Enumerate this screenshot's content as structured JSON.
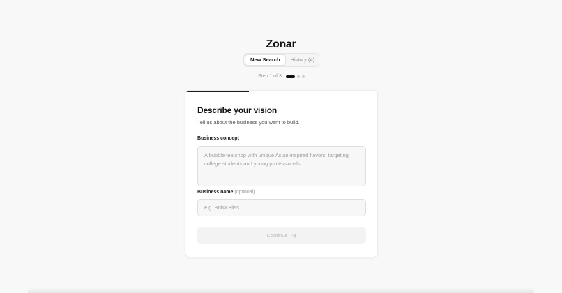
{
  "app": {
    "brand": "Zonar"
  },
  "tabs": [
    {
      "label": "New Search",
      "active": true
    },
    {
      "label": "History (4)",
      "active": false
    }
  ],
  "stepper": {
    "text": "Step 1 of 3",
    "current": 1,
    "total": 3
  },
  "card": {
    "progress_fraction": 0.33,
    "title": "Describe your vision",
    "subtitle": "Tell us about the business you want to build.",
    "concept_field": {
      "label": "Business concept",
      "placeholder": "A bubble tea shop with unique Asian-inspired flavors, targeting college students and young professionals...",
      "value": ""
    },
    "name_field": {
      "label": "Business name",
      "optional_tag": "(optional)",
      "placeholder": "e.g. Boba Bliss",
      "value": ""
    },
    "continue_button": {
      "label": "Continue",
      "icon": "arrow-right-icon",
      "enabled": false
    }
  },
  "colors": {
    "background": "#f8f8f8",
    "card": "#ffffff",
    "accent": "#111111",
    "disabled_text": "#b9b9b9"
  }
}
